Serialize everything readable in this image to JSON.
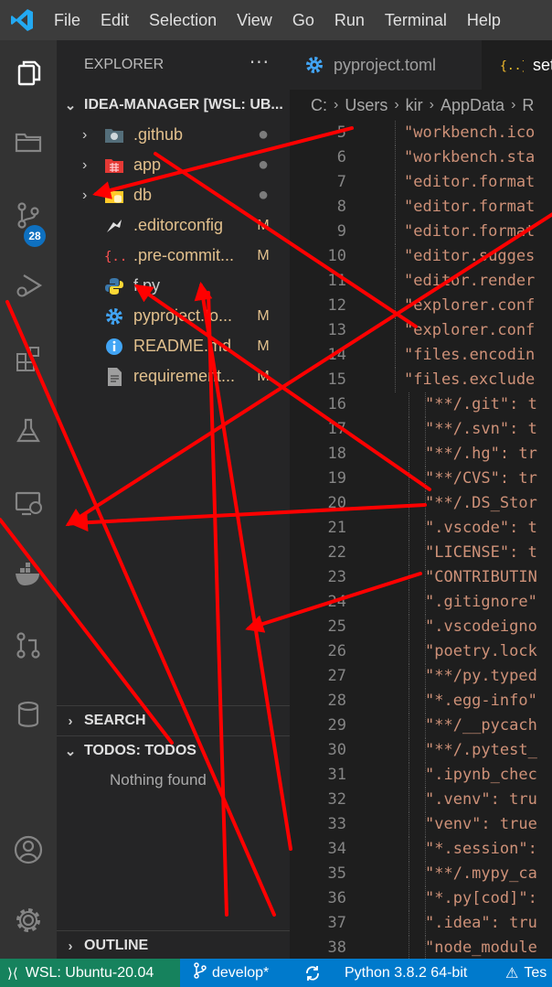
{
  "menu": [
    "File",
    "Edit",
    "Selection",
    "View",
    "Go",
    "Run",
    "Terminal",
    "Help"
  ],
  "activity_bar": {
    "items": [
      "explorer-icon",
      "search-icon",
      "source-control-icon",
      "run-debug-icon",
      "extensions-icon",
      "testing-icon",
      "remote-explorer-icon",
      "docker-icon",
      "pull-requests-icon",
      "database-icon"
    ],
    "scm_badge": "28",
    "bottom": [
      "account-icon",
      "settings-gear-icon"
    ]
  },
  "explorer": {
    "title": "EXPLORER",
    "more": "···",
    "root": "IDEA-MANAGER [WSL: UB...",
    "files": [
      {
        "name": ".github",
        "type": "folder",
        "deco": "●"
      },
      {
        "name": "app",
        "type": "folder",
        "deco": "●"
      },
      {
        "name": "db",
        "type": "folder",
        "deco": "●"
      },
      {
        "name": ".editorconfig",
        "type": "file",
        "deco": "M"
      },
      {
        "name": ".pre-commit...",
        "type": "file",
        "deco": "M"
      },
      {
        "name": "f.py",
        "type": "file",
        "deco": ""
      },
      {
        "name": "pyproject.to...",
        "type": "file",
        "deco": "M"
      },
      {
        "name": "README.md",
        "type": "file",
        "deco": "M"
      },
      {
        "name": "requirement...",
        "type": "file",
        "deco": "M"
      }
    ],
    "search_section": "SEARCH",
    "todos_section": "TODOS: TODOS",
    "todos_empty": "Nothing found",
    "outline_section": "OUTLINE"
  },
  "tabs": [
    {
      "label": "pyproject.toml",
      "icon": "gear-file-icon"
    },
    {
      "label": "set",
      "icon": "json-file-icon"
    }
  ],
  "breadcrumb": [
    "C:",
    "Users",
    "kir",
    "AppData",
    "R"
  ],
  "code": [
    {
      "n": "5",
      "text": "\"workbench.ico",
      "indent": 0
    },
    {
      "n": "6",
      "text": "\"workbench.sta",
      "indent": 0
    },
    {
      "n": "7",
      "text": "\"editor.format",
      "indent": 0
    },
    {
      "n": "8",
      "text": "\"editor.format",
      "indent": 0
    },
    {
      "n": "9",
      "text": "\"editor.format",
      "indent": 0
    },
    {
      "n": "10",
      "text": "\"editor.sugges",
      "indent": 0
    },
    {
      "n": "11",
      "text": "\"editor.render",
      "indent": 0
    },
    {
      "n": "12",
      "text": "\"explorer.conf",
      "indent": 0
    },
    {
      "n": "13",
      "text": "\"explorer.conf",
      "indent": 0
    },
    {
      "n": "14",
      "text": "\"files.encodin",
      "indent": 0
    },
    {
      "n": "15",
      "text": "\"files.exclude",
      "indent": 0
    },
    {
      "n": "16",
      "text": "\"**/.git\": t",
      "indent": 1
    },
    {
      "n": "17",
      "text": "\"**/.svn\": t",
      "indent": 1
    },
    {
      "n": "18",
      "text": "\"**/.hg\": tr",
      "indent": 1
    },
    {
      "n": "19",
      "text": "\"**/CVS\": tr",
      "indent": 1
    },
    {
      "n": "20",
      "text": "\"**/.DS_Stor",
      "indent": 1
    },
    {
      "n": "21",
      "text": "\".vscode\": t",
      "indent": 1
    },
    {
      "n": "22",
      "text": "\"LICENSE\": t",
      "indent": 1
    },
    {
      "n": "23",
      "text": "\"CONTRIBUTIN",
      "indent": 1
    },
    {
      "n": "24",
      "text": "\".gitignore\"",
      "indent": 1
    },
    {
      "n": "25",
      "text": "\".vscodeigno",
      "indent": 1
    },
    {
      "n": "26",
      "text": "\"poetry.lock",
      "indent": 1
    },
    {
      "n": "27",
      "text": "\"**/py.typed",
      "indent": 1
    },
    {
      "n": "28",
      "text": "\"*.egg-info\"",
      "indent": 1
    },
    {
      "n": "29",
      "text": "\"**/__pycach",
      "indent": 1
    },
    {
      "n": "30",
      "text": "\"**/.pytest_",
      "indent": 1
    },
    {
      "n": "31",
      "text": "\".ipynb_chec",
      "indent": 1
    },
    {
      "n": "32",
      "text": "\".venv\": tru",
      "indent": 1
    },
    {
      "n": "33",
      "text": "\"venv\": true",
      "indent": 1
    },
    {
      "n": "34",
      "text": "\"*.session\":",
      "indent": 1
    },
    {
      "n": "35",
      "text": "\"**/.mypy_ca",
      "indent": 1
    },
    {
      "n": "36",
      "text": "\"*.py[cod]\":",
      "indent": 1
    },
    {
      "n": "37",
      "text": "\".idea\": tru",
      "indent": 1
    },
    {
      "n": "38",
      "text": "\"node_module",
      "indent": 1
    }
  ],
  "status": {
    "remote": "WSL: Ubuntu-20.04",
    "branch": "develop*",
    "python": "Python 3.8.2 64-bit",
    "test": "Tes"
  },
  "colors": {
    "annotation": "#ff0000",
    "status_bar": "#007acc",
    "remote_indicator": "#16825d",
    "badge": "#0e70c0"
  }
}
